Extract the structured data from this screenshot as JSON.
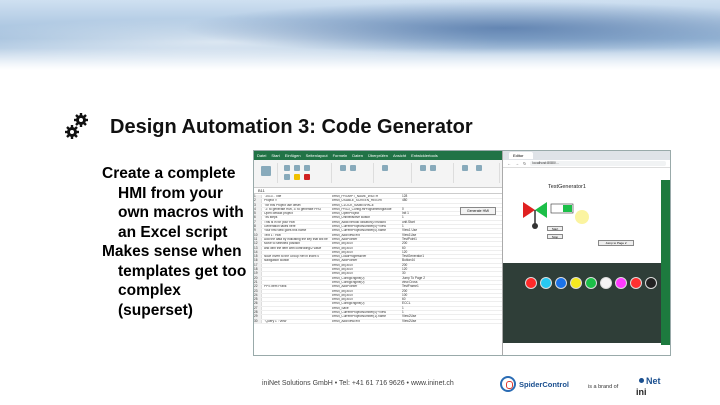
{
  "slide": {
    "title": "Design Automation 3: Code Generator",
    "bullets": [
      [
        "Create a complete",
        "HMI from your",
        "own macros with",
        "an Excel script"
      ],
      [
        "Makes sense when",
        "templates get too",
        "complex",
        "(superset)"
      ]
    ]
  },
  "excel": {
    "tabs": [
      "Datei",
      "Start",
      "Einfügen",
      "Seitenlayout",
      "Formeln",
      "Daten",
      "Überprüfen",
      "Ansicht",
      "Entwicklertools"
    ],
    "name_box": "B11",
    "generate_button": "Generate HMI",
    "rows": [
      [
        "1",
        "' 2013 - Title",
        "#HMI_PROMPT_NAME_WIDTH",
        "128"
      ],
      [
        "2",
        "Project !!",
        "#HMI_USABLE_SCREEN_HEIGHT",
        "480"
      ],
      [
        "3",
        "' for this Project use offset",
        "#HMI_CLOCK_NAMESPACE",
        ""
      ],
      [
        "4",
        "' 2: to generate HMI, 3: to generate PRO",
        "#HMI_PROJ_Config.mProgrammingMode",
        "0"
      ],
      [
        "5",
        "Open default project",
        "#HMI_OpenProject",
        "Init 1"
      ],
      [
        "6",
        "' Its steps",
        "#HMI_Uninteractive Button",
        "1"
      ],
      [
        "7",
        "This is in for your HMI",
        "#HMI_AddExtHookToButton(0 nMacro",
        "unit.Start"
      ],
      [
        "8",
        "Generation takes here",
        "#HMI_CurrentProjectNumber(0)+View",
        "1"
      ],
      [
        "9",
        "Your first view goes this name",
        "#HMI_CurrentProjectNumber(0).name",
        "View1 Use"
      ],
      [
        "10",
        "Text 1 : HMI",
        "#HMI_AddViewText",
        "View1Use"
      ],
      [
        "11",
        "Add the data by indicating the key that will be",
        "#HMI_AddPointer",
        "TestPoint1"
      ],
      [
        "12",
        "Move to selected position",
        "#HMI_obj.xcl.x",
        "200"
      ],
      [
        "13",
        "and with the item with controlling/2 value",
        "#HMI_obj.xcl.x",
        "60"
      ],
      [
        "14",
        "",
        "#HMI_obj.xcl.x",
        "120"
      ],
      [
        "15",
        "Now! Invert to the Group Ref in index 0",
        "#HMI_LoadProgressRef",
        "TestGenerator1"
      ],
      [
        "16",
        "Navigation Button",
        "#HMI_AddPointer",
        "Button44"
      ],
      [
        "17",
        "",
        "#HMI_obj.xcl.x",
        "200"
      ],
      [
        "18",
        "",
        "#HMI_obj.xcl.x",
        "120"
      ],
      [
        "19",
        "",
        "#HMI_obj.xcl.x",
        "30"
      ],
      [
        "20",
        "",
        "#HMI_ConfigEngine(0)",
        "Jump To Page 2"
      ],
      [
        "21",
        "",
        "#HMI_ConfigEngine(0)",
        "view.Cross"
      ],
      [
        "22",
        "PPS Item Frank",
        "#HMI_AddPointer",
        "TestFrame1"
      ],
      [
        "23",
        "",
        "#HMI_obj.xcl.x",
        "200"
      ],
      [
        "24",
        "",
        "#HMI_obj.xcl.x",
        "100"
      ],
      [
        "25",
        "",
        "#HMI_obj.xcl.x",
        "60"
      ],
      [
        "26",
        "",
        "#HMI_ConfigEngine(0)",
        "ECCL"
      ],
      [
        "27",
        "",
        "#HMI_Save",
        "1"
      ],
      [
        "28",
        "",
        "#HMI_CurrentProjectNumber(0)+View",
        "1"
      ],
      [
        "29",
        "",
        "#HMI_CurrentProjectNumber(1).name",
        "View2Use"
      ],
      [
        "30",
        "' Query 1 : View",
        "#HMI_AddViewText",
        "View2Use"
      ]
    ]
  },
  "browser": {
    "tab_title": "Editor",
    "url": "localhost:8080/...",
    "hmi_title": "TestGenerator1",
    "input_value": "",
    "buttons": [
      "Start",
      "Stop",
      "Jump to Page 2"
    ]
  },
  "palette_colors": [
    "#ff2a2a",
    "#27c9f1",
    "#1b73e8",
    "#f4e820",
    "#1bbf48",
    "#f4f4f4",
    "#ff3aff",
    "#ff3030",
    "#222222"
  ],
  "footer": {
    "contact": "iniNet Solutions GmbH • Tel: +41 61 716 9626 • www.ininet.ch",
    "logo_name": "SpiderControl",
    "brand_text": "is a brand of",
    "ini_top": "Net",
    "ini_bottom": "ini"
  }
}
